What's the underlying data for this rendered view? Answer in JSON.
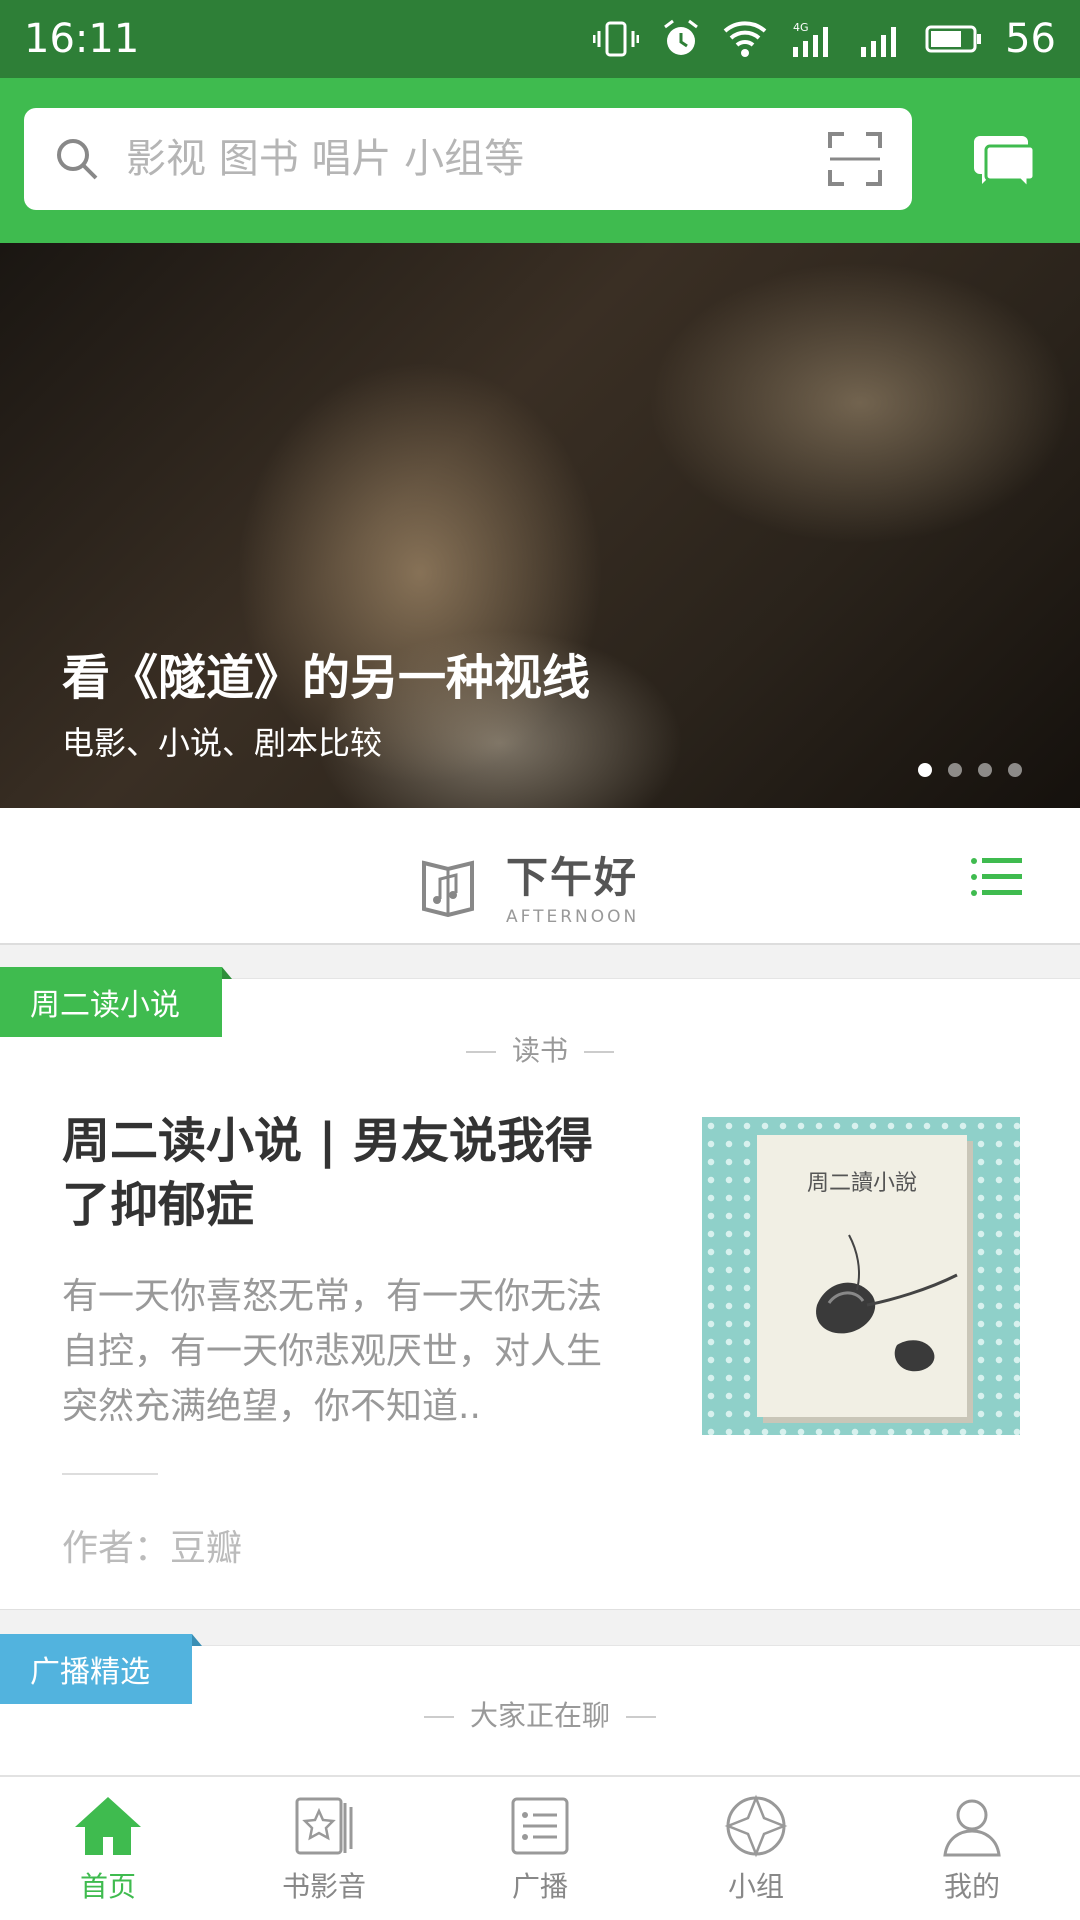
{
  "status_bar": {
    "time": "16:11",
    "battery": "56"
  },
  "search": {
    "placeholder": "影视 图书 唱片 小组等"
  },
  "banner": {
    "title": "看《隧道》的另一种视线",
    "subtitle": "电影、小说、剧本比较",
    "dots": 4,
    "active_dot": 0
  },
  "greeting": {
    "main": "下午好",
    "sub": "AFTERNOON"
  },
  "card1": {
    "tag": "周二读小说",
    "section": "读书",
    "title": "周二读小说 | 男友说我得了抑郁症",
    "excerpt": "有一天你喜怒无常，有一天你无法自控，有一天你悲观厌世，对人生突然充满绝望，你不知道..",
    "author": "作者：豆瓣",
    "thumb_text": "周二讀小說"
  },
  "card2": {
    "tag": "广播精选",
    "section": "大家正在聊"
  },
  "nav": [
    {
      "label": "首页",
      "icon": "home-icon",
      "active": true
    },
    {
      "label": "书影音",
      "icon": "media-icon",
      "active": false
    },
    {
      "label": "广播",
      "icon": "broadcast-icon",
      "active": false
    },
    {
      "label": "小组",
      "icon": "group-icon",
      "active": false
    },
    {
      "label": "我的",
      "icon": "profile-icon",
      "active": false
    }
  ],
  "colors": {
    "brand": "#3fbb4f",
    "status_bar": "#2e7f37",
    "tag_blue": "#52b3de"
  }
}
